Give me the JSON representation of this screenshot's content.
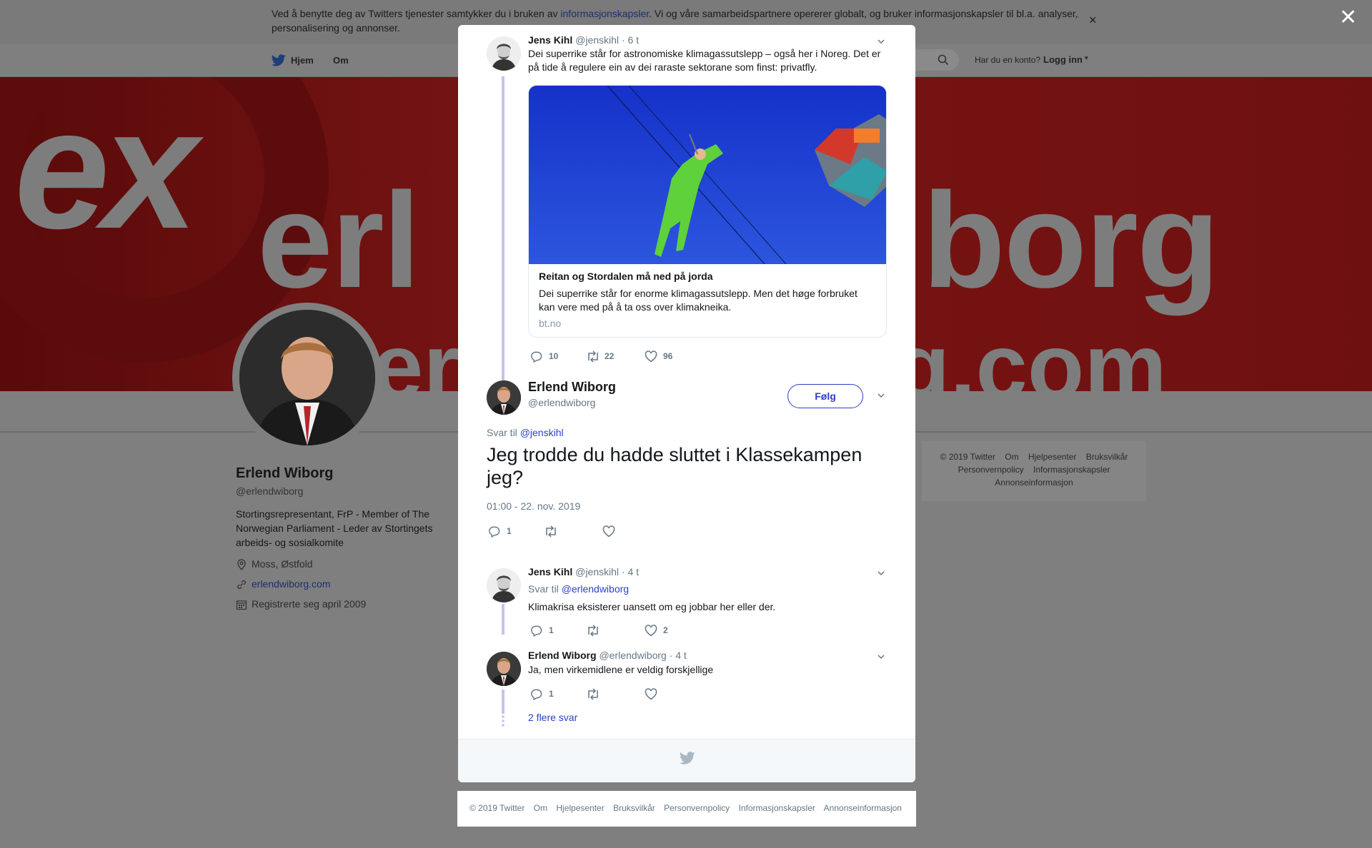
{
  "cookie_bar": {
    "text_before": "Ved å benytte deg av Twitters tjenester samtykker du i bruken av ",
    "link": "informasjonskapsler",
    "text_after": ". Vi og våre samarbeidspartnere opererer globalt, og bruker informasjonskapsler til bl.a. analyser, personalisering og annonser.",
    "close": "×"
  },
  "nav": {
    "home": "Hjem",
    "about": "Om",
    "login_question": "Har du en konto?",
    "login": "Logg inn",
    "login_caret": "▾"
  },
  "banner": {
    "t1": "ex",
    "t2": "erl",
    "t3": "iborg",
    "t4": "er",
    "t5": "g.com"
  },
  "profile": {
    "name": "Erlend Wiborg",
    "handle": "@erlendwiborg",
    "bio": "Stortingsrepresentant, FrP - Member of The Norwegian Parliament - Leder av Stortingets arbeids- og sosialkomite",
    "location": "Moss, Østfold",
    "website": "erlendwiborg.com",
    "joined": "Registrerte seg april 2009"
  },
  "side_footer": {
    "row1": [
      "© 2019 Twitter",
      "Om",
      "Hjelpesenter",
      "Bruksvilkår"
    ],
    "row2": [
      "Personvernpolicy",
      "Informasjonskapsler"
    ],
    "row3": [
      "Annonseinformasjon"
    ]
  },
  "overlay_close": "✕",
  "thread": {
    "parent": {
      "name": "Jens Kihl",
      "handle": "@jenskihl",
      "time": "· 6 t",
      "text": "Dei superrike står for astronomiske klimagassutslepp – også her i Noreg. Det er på tide å regulere ein av dei raraste sektorane som finst: privatfly.",
      "card": {
        "title": "Reitan og Stordalen må ned på jorda",
        "description": "Dei superrike står for enorme klimagassutslepp. Men det høge forbruket kan vere med på å ta oss over klimakneika.",
        "domain": "bt.no"
      },
      "replies": "10",
      "retweets": "22",
      "likes": "96"
    },
    "main": {
      "name": "Erlend Wiborg",
      "handle": "@erlendwiborg",
      "follow": "Følg",
      "reply_to_label": "Svar til",
      "reply_to": "@jenskihl",
      "text": "Jeg trodde du hadde sluttet i Klassekampen jeg?",
      "timestamp": "01:00 - 22. nov. 2019",
      "replies": "1"
    },
    "reply1": {
      "name": "Jens Kihl",
      "handle": "@jenskihl",
      "time": "· 4 t",
      "reply_to_label": "Svar til",
      "reply_to": "@erlendwiborg",
      "text": "Klimakrisa eksisterer uansett om eg jobbar her eller der.",
      "replies": "1",
      "likes": "2"
    },
    "reply2": {
      "name": "Erlend Wiborg",
      "handle": "@erlendwiborg",
      "time": "· 4 t",
      "text": "Ja, men virkemidlene er veldig forskjellige",
      "replies": "1"
    },
    "more_replies": "2 flere svar"
  },
  "page_footer": [
    "© 2019 Twitter",
    "Om",
    "Hjelpesenter",
    "Bruksvilkår",
    "Personvernpolicy",
    "Informasjonskapsler",
    "Annonseinformasjon"
  ],
  "colors": {
    "link": "#2b3fc7",
    "thread_line": "#c4c2ec",
    "overlay": "#7f7f7f"
  }
}
